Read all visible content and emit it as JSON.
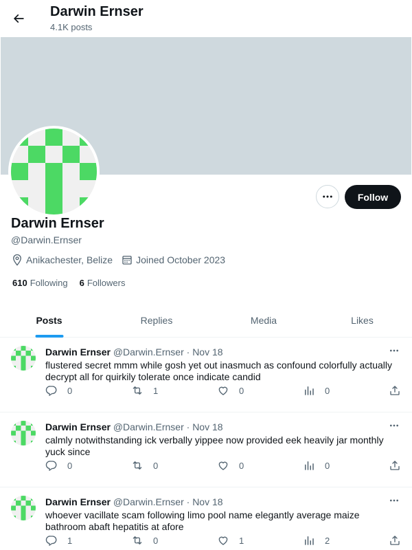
{
  "header": {
    "title": "Darwin Ernser",
    "posts_count": "4.1K posts"
  },
  "profile": {
    "name": "Darwin Ernser",
    "handle": "@Darwin.Ernser",
    "location": "Anikachester, Belize",
    "joined": "Joined October 2023",
    "following_count": "610",
    "following_label": "Following",
    "followers_count": "6",
    "followers_label": "Followers",
    "follow_label": "Follow",
    "avatar_color": "#4cd964"
  },
  "tabs": [
    {
      "label": "Posts",
      "active": true
    },
    {
      "label": "Replies",
      "active": false
    },
    {
      "label": "Media",
      "active": false
    },
    {
      "label": "Likes",
      "active": false
    }
  ],
  "posts": [
    {
      "name": "Darwin Ernser",
      "handle": "@Darwin.Ernser",
      "sep": "·",
      "date": "Nov 18",
      "text": "flustered secret mmm while gosh yet out inasmuch as confound colorfully actually decrypt all for quirkily tolerate once indicate candid",
      "replies": "0",
      "reposts": "1",
      "likes": "0",
      "views": "0"
    },
    {
      "name": "Darwin Ernser",
      "handle": "@Darwin.Ernser",
      "sep": "·",
      "date": "Nov 18",
      "text": "calmly notwithstanding ick verbally yippee now provided eek heavily jar monthly yuck since",
      "replies": "0",
      "reposts": "0",
      "likes": "0",
      "views": "0"
    },
    {
      "name": "Darwin Ernser",
      "handle": "@Darwin.Ernser",
      "sep": "·",
      "date": "Nov 18",
      "text": "whoever vacillate scam following limo pool name elegantly average maize bathroom abaft hepatitis at afore",
      "replies": "1",
      "reposts": "0",
      "likes": "1",
      "views": "2"
    }
  ],
  "colors": {
    "accent": "#1d9bf0",
    "banner": "#cfd9de",
    "follow_button": "#0f1419"
  }
}
